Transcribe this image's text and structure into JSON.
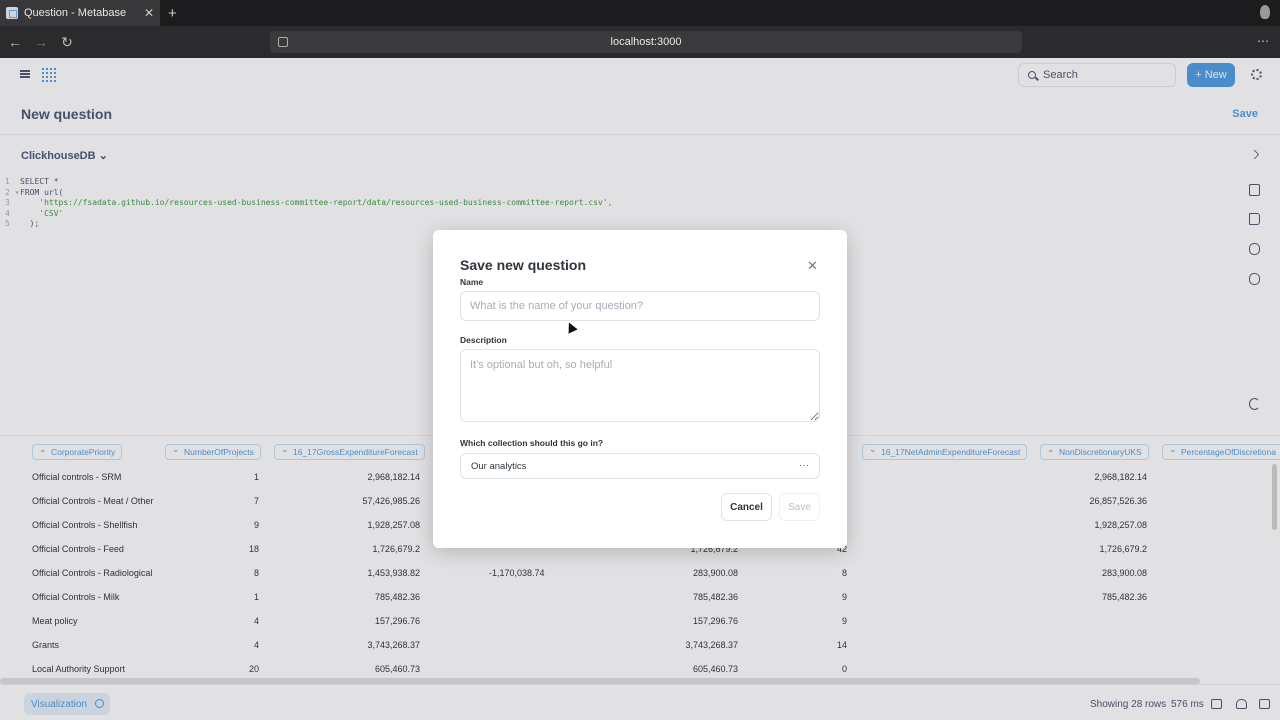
{
  "browser": {
    "tab_title": "Question - Metabase",
    "tab_close": "✕",
    "new_tab": "+",
    "url": "localhost:3000",
    "back": "←",
    "forward": "→",
    "reload": "↻",
    "menu": "⋯"
  },
  "nav": {
    "search_placeholder": "Search",
    "new_label": "New",
    "new_plus": "+"
  },
  "question": {
    "title": "New question",
    "save_label": "Save",
    "database": "ClickhouseDB ⌄"
  },
  "editor": {
    "lines": [
      {
        "num": "1",
        "text": "SELECT *"
      },
      {
        "num": "2 ▾",
        "text": "FROM url("
      },
      {
        "num": "3",
        "text": "    'https://fsadata.github.io/resources-used-business-committee-report/data/resources-used-business-committee-report.csv',"
      },
      {
        "num": "4",
        "text": "    'CSV'"
      },
      {
        "num": "5",
        "text": "  );"
      }
    ]
  },
  "table": {
    "headers": [
      "CorporatePriority",
      "NumberOfProjects",
      "16_17GrossExpenditureForecast",
      "16_17NetAdminExpenditureForecast",
      "NonDiscretionaryUKS",
      "PercentageOfDiscretiona"
    ],
    "rows": [
      [
        "Official controls - SRM",
        "1",
        "2,968,182.14",
        "",
        "",
        "",
        "2,968,182.14"
      ],
      [
        "Official Controls - Meat / Other",
        "7",
        "57,426,985.26",
        "",
        "",
        "",
        "26,857,526.36"
      ],
      [
        "Official Controls - Shellfish",
        "9",
        "1,928,257.08",
        "",
        "",
        "",
        "1,928,257.08"
      ],
      [
        "Official Controls - Feed",
        "18",
        "1,726,679.2",
        "",
        "1,726,679.2",
        "42",
        "1,726,679.2"
      ],
      [
        "Official Controls - Radiological",
        "8",
        "1,453,938.82",
        "-1,170,038.74",
        "283,900.08",
        "8",
        "283,900.08"
      ],
      [
        "Official Controls - Milk",
        "1",
        "785,482.36",
        "",
        "785,482.36",
        "9",
        "785,482.36"
      ],
      [
        "Meat policy",
        "4",
        "157,296.76",
        "",
        "157,296.76",
        "9",
        ""
      ],
      [
        "Grants",
        "4",
        "3,743,268.37",
        "",
        "3,743,268.37",
        "14",
        ""
      ],
      [
        "Local Authority Support",
        "20",
        "605,460.73",
        "",
        "605,460.73",
        "0",
        ""
      ]
    ]
  },
  "footer": {
    "viz_label": "Visualization",
    "row_count": "Showing 28 rows",
    "timing": "576 ms"
  },
  "modal": {
    "title": "Save new question",
    "close": "✕",
    "name_label": "Name",
    "name_placeholder": "What is the name of your question?",
    "description_label": "Description",
    "description_placeholder": "It's optional but oh, so helpful",
    "collection_label": "Which collection should this go in?",
    "collection_value": "Our analytics",
    "collection_more": "···",
    "cancel_label": "Cancel",
    "save_label": "Save"
  }
}
